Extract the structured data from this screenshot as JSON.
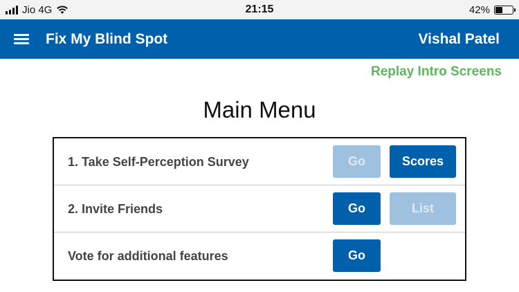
{
  "status_bar": {
    "carrier": "Jio 4G",
    "time": "21:15",
    "battery_percent": "42%",
    "battery_level": 0.42
  },
  "app_bar": {
    "title": "Fix My Blind Spot",
    "user_name": "Vishal Patel",
    "color": "#0060ac"
  },
  "replay_link": "Replay Intro Screens",
  "page_title": "Main Menu",
  "menu_rows": [
    {
      "label": "1. Take Self-Perception Survey",
      "go_label": "Go",
      "go_enabled": false,
      "second_label": "Scores",
      "second_enabled": true
    },
    {
      "label": "2. Invite Friends",
      "go_label": "Go",
      "go_enabled": true,
      "second_label": "List",
      "second_enabled": false
    },
    {
      "label": "Vote for additional features",
      "go_label": "Go",
      "go_enabled": true
    }
  ],
  "colors": {
    "primary": "#0060ac",
    "disabled": "#9ec1e0",
    "link_green": "#5cb85c"
  }
}
